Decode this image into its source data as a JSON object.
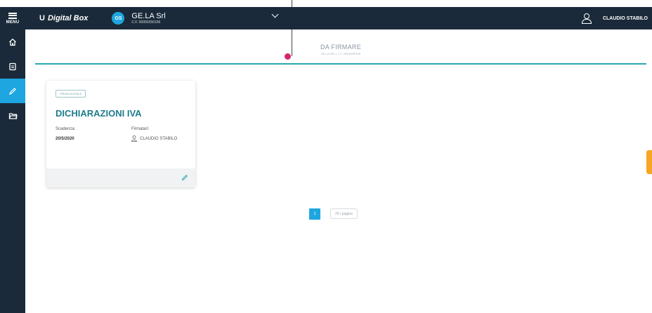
{
  "topbar": {
    "menu_label": "MENU",
    "brand_logo": "U",
    "brand_name": "Digital Box",
    "company_initials": "GS",
    "company_name": "GE.LA Srl",
    "company_code": "C.F. 00000250156",
    "user_name": "CLAUDIO STABILO"
  },
  "page": {
    "title": "DA FIRMARE",
    "subtitle": "GE.LA SRL | C.F. 00000250156"
  },
  "card": {
    "tag": "FIRMA DIGITALE",
    "title": "DICHIARAZIONI IVA",
    "deadline_label": "Scadenza:",
    "deadline_value": "20/5/2020",
    "signers_label": "Firmatari:",
    "signer_name": "CLAUDIO STABILO"
  },
  "pagination": {
    "current_page": "1",
    "per_page": "20 / pagina"
  },
  "colors": {
    "topbar_bg": "#1a2a3a",
    "accent": "#1ea6e0",
    "title_teal": "#1e7c8c",
    "divider_teal": "#2aa7b4",
    "pointer_dot": "#d6246e",
    "side_tab": "#f6a623"
  },
  "icons": [
    "menu-icon",
    "user-icon",
    "chevron-down-icon",
    "home-icon",
    "document-icon",
    "pen-icon",
    "folder-icon",
    "edit-icon"
  ]
}
